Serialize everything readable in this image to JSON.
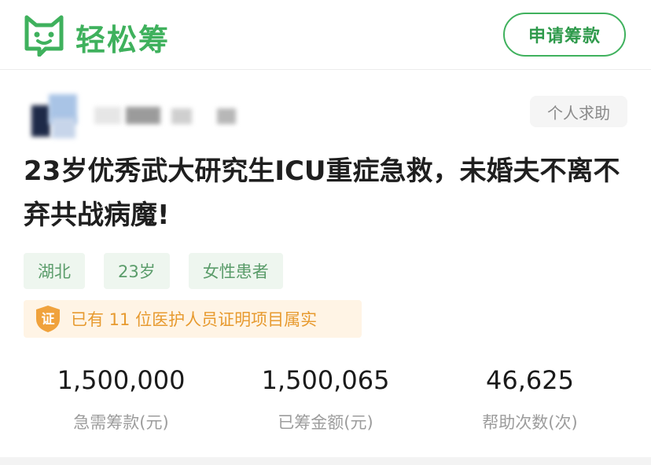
{
  "brand": {
    "name": "轻松筹",
    "color": "#3fb15d"
  },
  "header": {
    "apply_button": "申请筹款"
  },
  "project": {
    "type_tag": "个人求助",
    "title": "23岁优秀武大研究生ICU重症急救，未婚夫不离不弃共战病魔!",
    "tags": [
      "湖北",
      "23岁",
      "女性患者"
    ],
    "verification": {
      "icon_text": "证",
      "text": "已有 11 位医护人员证明项目属实"
    }
  },
  "stats": [
    {
      "value": "1,500,000",
      "label": "急需筹款(元)"
    },
    {
      "value": "1,500,065",
      "label": "已筹金额(元)"
    },
    {
      "value": "46,625",
      "label": "帮助次数(次)"
    }
  ],
  "icons": {
    "logo": "cat-face-logo-icon",
    "verify": "shield-badge-icon"
  },
  "colors": {
    "verify_bg": "#fff4e5",
    "verify_text": "#e79a2f",
    "tag_bg": "#eef6ef",
    "tag_text": "#5a9c6a"
  }
}
